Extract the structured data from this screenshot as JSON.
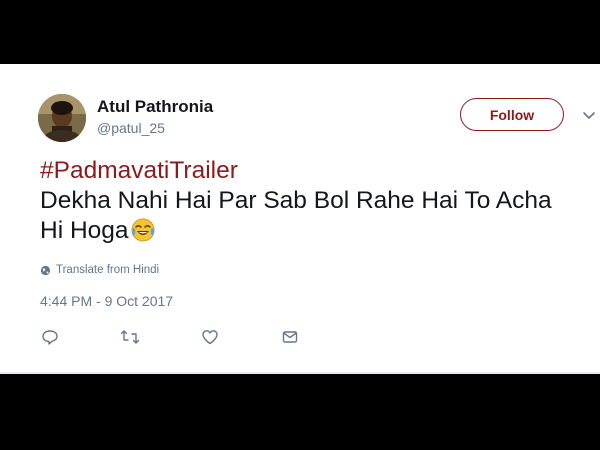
{
  "tweet": {
    "author": {
      "display_name": "Atul Pathronia",
      "handle": "@patul_25"
    },
    "follow_label": "Follow",
    "hashtag": "#PadmavatiTrailer",
    "body_line1": "Dekha Nahi Hai Par Sab Bol Rahe Hai To Acha",
    "body_line2": "Hi Hoga",
    "emoji": "face-with-tears-of-joy",
    "translate_label": "Translate from Hindi",
    "timestamp": "4:44 PM - 9 Oct 2017",
    "actions": [
      "reply-icon",
      "retweet-icon",
      "like-icon",
      "direct-message-icon"
    ]
  },
  "colors": {
    "accent": "#8b1a1a",
    "text_primary": "#14171a",
    "text_secondary": "#657786",
    "background_frame": "#000000",
    "card_background": "#ffffff"
  }
}
